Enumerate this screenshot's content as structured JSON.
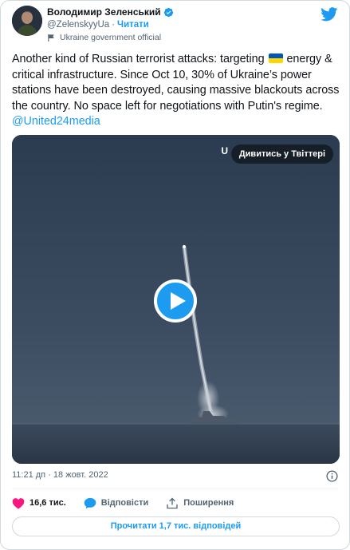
{
  "author": {
    "display_name": "Володимир Зеленський",
    "handle": "@ZelenskyyUa",
    "separator": "·",
    "follow_label": "Читати",
    "affiliation_label": "Ukraine government official"
  },
  "tweet": {
    "text_part1": "Another kind of Russian terrorist attacks: targeting",
    "text_part2": "energy & critical infrastructure. Since Oct 10, 30% of Ukraine’s power stations have been destroyed, causing massive blackouts across the country. No space left for negotiations with Putin's regime. ",
    "mention": "@United24media"
  },
  "media": {
    "watch_label": "Дивитись у Твіттері",
    "watermark": "U"
  },
  "meta": {
    "timestamp": "11:21 дп · 18 жовт. 2022"
  },
  "actions": {
    "likes_count": "16,6 тис.",
    "reply_label": "Відповісти",
    "share_label": "Поширення"
  },
  "read_replies_label": "Прочитати 1,7 тис. відповідей",
  "colors": {
    "accent": "#1d9bf0",
    "like": "#f91880",
    "ua_blue": "#0057b7",
    "ua_yellow": "#ffd700"
  }
}
